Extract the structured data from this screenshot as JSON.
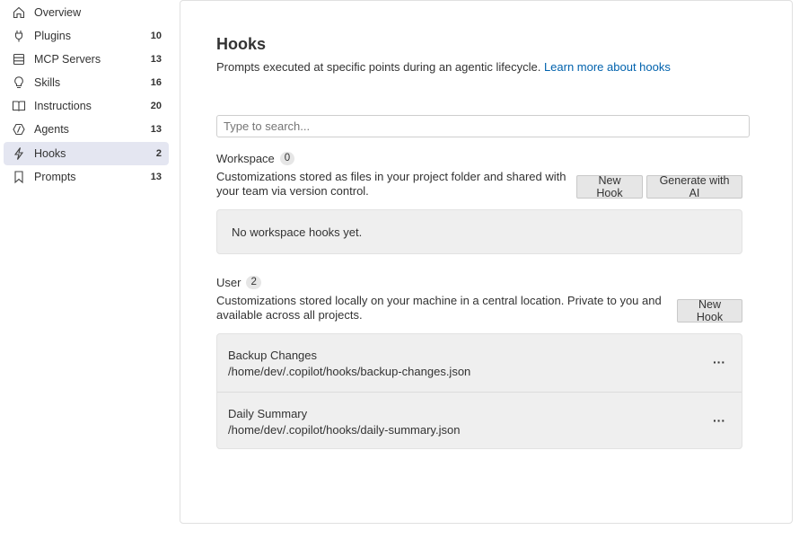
{
  "sidebar": {
    "items": [
      {
        "label": "Overview",
        "count": "",
        "icon": "home-icon",
        "active": false
      },
      {
        "label": "Plugins",
        "count": "10",
        "icon": "plug-icon",
        "active": false
      },
      {
        "label": "MCP Servers",
        "count": "13",
        "icon": "server-icon",
        "active": false
      },
      {
        "label": "Skills",
        "count": "16",
        "icon": "lightbulb-icon",
        "active": false
      },
      {
        "label": "Instructions",
        "count": "20",
        "icon": "book-icon",
        "active": false
      },
      {
        "label": "Agents",
        "count": "13",
        "icon": "agent-icon",
        "active": false
      },
      {
        "label": "Hooks",
        "count": "2",
        "icon": "lightning-icon",
        "active": true
      },
      {
        "label": "Prompts",
        "count": "13",
        "icon": "bookmark-icon",
        "active": false
      }
    ]
  },
  "main": {
    "title": "Hooks",
    "subtitle": "Prompts executed at specific points during an agentic lifecycle.",
    "learn_more": "Learn more about hooks",
    "search_placeholder": "Type to search...",
    "workspace": {
      "title": "Workspace",
      "count": "0",
      "desc_line1": "Customizations stored as files in your project folder and shared with",
      "desc_line2": "your team via version control.",
      "new_hook": "New Hook",
      "generate": "Generate with AI",
      "empty": "No workspace hooks yet."
    },
    "user": {
      "title": "User",
      "count": "2",
      "desc_line1": "Customizations stored locally on your machine in a central location. Private to you and",
      "desc_line2": "available across all projects.",
      "new_hook": "New Hook",
      "hooks": [
        {
          "name": "Backup Changes",
          "path": "/home/dev/.copilot/hooks/backup-changes.json",
          "more": "···"
        },
        {
          "name": "Daily Summary",
          "path": "/home/dev/.copilot/hooks/daily-summary.json",
          "more": "···"
        }
      ]
    }
  },
  "colors": {
    "active_bg": "#e4e6f1",
    "link": "#0062ad",
    "button_bg": "#e6e6e6"
  }
}
